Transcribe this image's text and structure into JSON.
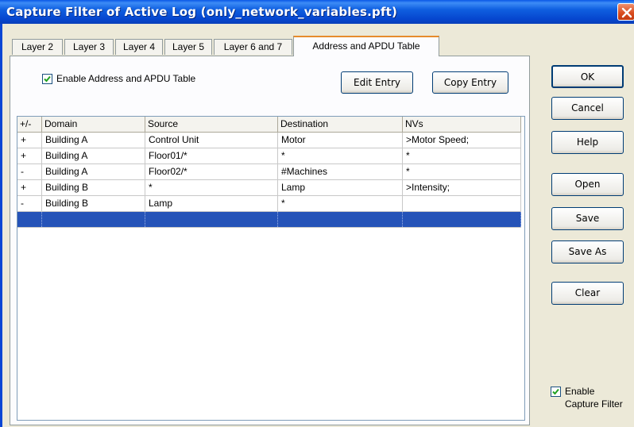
{
  "window": {
    "title": "Capture Filter of Active Log (only_network_variables.pft)"
  },
  "tabs": [
    {
      "label": "Layer 2"
    },
    {
      "label": "Layer 3"
    },
    {
      "label": "Layer 4"
    },
    {
      "label": "Layer 5"
    },
    {
      "label": "Layer 6 and 7"
    },
    {
      "label": "Address and APDU Table"
    }
  ],
  "active_tab": "Address and APDU Table",
  "panel": {
    "enable_label": "Enable Address and APDU Table",
    "enable_checked": true,
    "edit_entry_label": "Edit Entry",
    "copy_entry_label": "Copy Entry"
  },
  "table": {
    "columns": [
      "+/-",
      "Domain",
      "Source",
      "Destination",
      "NVs"
    ],
    "rows": [
      [
        "+",
        "Building A",
        "Control Unit",
        "Motor",
        ">Motor Speed;"
      ],
      [
        "+",
        "Building A",
        "Floor01/*",
        "*",
        "*"
      ],
      [
        "-",
        "Building A",
        "Floor02/*",
        "#Machines",
        "*"
      ],
      [
        "+",
        "Building B",
        "*",
        "Lamp",
        ">Intensity;"
      ],
      [
        "-",
        "Building B",
        "Lamp",
        "*",
        ""
      ],
      [
        "",
        "",
        "",
        "",
        ""
      ]
    ],
    "selected_row": 5
  },
  "sidebar": {
    "ok_label": "OK",
    "cancel_label": "Cancel",
    "help_label": "Help",
    "open_label": "Open",
    "save_label": "Save",
    "save_as_label": "Save As",
    "clear_label": "Clear",
    "enable_capture_line1": "Enable",
    "enable_capture_line2": "Capture Filter",
    "enable_capture_checked": true
  },
  "colors": {
    "title_bar": "#0a58e6",
    "selection": "#2553b8",
    "close_button": "#d84a1c",
    "active_tab_accent": "#e68b2c"
  }
}
